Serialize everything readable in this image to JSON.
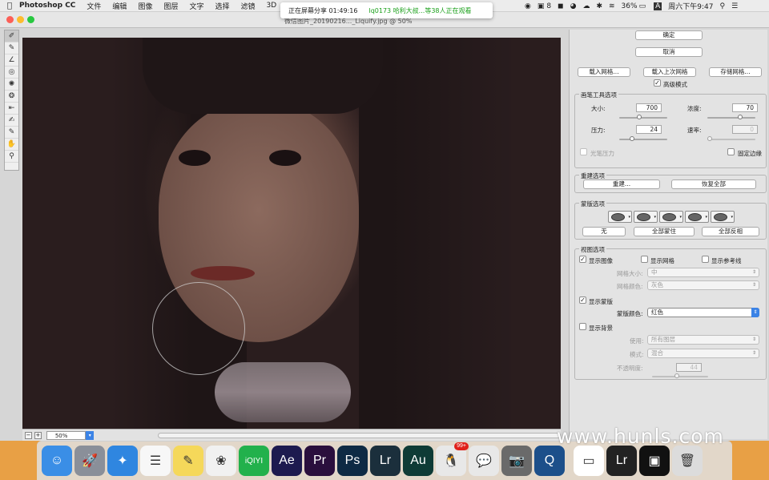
{
  "menubar": {
    "apple": "",
    "app_name": "Photoshop CC",
    "items": [
      "文件",
      "编辑",
      "图像",
      "图层",
      "文字",
      "选择",
      "滤镜",
      "3D"
    ],
    "status": {
      "badge": "8",
      "battery": "36%",
      "input_method": "A",
      "clock": "周六下午9:47"
    }
  },
  "share_banner": {
    "status": "正在屏幕分享 01:49:16",
    "viewers": "lq0173 哈利大叔...等38人正在观看"
  },
  "window": {
    "file_title": "微信图片_20190216..._Liquify.jpg @ 50%"
  },
  "toolbar": {
    "tools": [
      {
        "name": "forward-warp-tool",
        "glyph": "✐"
      },
      {
        "name": "reconstruct-tool",
        "glyph": "✎"
      },
      {
        "name": "smooth-tool",
        "glyph": "∠"
      },
      {
        "name": "twirl-clockwise-tool",
        "glyph": "◎"
      },
      {
        "name": "pucker-tool",
        "glyph": "✺"
      },
      {
        "name": "bloat-tool",
        "glyph": "❂"
      },
      {
        "name": "push-left-tool",
        "glyph": "⇤"
      },
      {
        "name": "freeze-mask-tool",
        "glyph": "✍"
      },
      {
        "name": "thaw-mask-tool",
        "glyph": "✎"
      },
      {
        "name": "hand-tool",
        "glyph": "✋"
      },
      {
        "name": "zoom-tool",
        "glyph": "⚲"
      }
    ]
  },
  "statusbar": {
    "zoom_out": "−",
    "zoom_in": "+",
    "zoom": "50%"
  },
  "panel": {
    "ok": "确定",
    "cancel": "取消",
    "load_mesh": "载入网格...",
    "load_last_mesh": "载入上次网格",
    "save_mesh": "存储网格...",
    "advanced_mode": "高级模式",
    "brush_options": {
      "title": "画笔工具选项",
      "size_label": "大小:",
      "size": "700",
      "density_label": "浓度:",
      "density": "70",
      "pressure_label": "压力:",
      "pressure": "24",
      "rate_label": "速率:",
      "rate": "0",
      "stylus_pressure": "光笔压力",
      "pin_edges": "固定边缘",
      "sliders": {
        "size": 0.4,
        "density": 0.7,
        "pressure": 0.24,
        "rate": 0.0
      }
    },
    "reconstruct_options": {
      "title": "重建选项",
      "reconstruct": "重建...",
      "restore_all": "恢复全部"
    },
    "mask_options": {
      "title": "蒙版选项",
      "none": "无",
      "mask_all": "全部蒙住",
      "invert_all": "全部反相"
    },
    "view_options": {
      "title": "视图选项",
      "show_image": "显示图像",
      "show_mesh": "显示网格",
      "show_guides": "显示参考线",
      "mesh_size_label": "网格大小:",
      "mesh_size": "中",
      "mesh_color_label": "网格颜色:",
      "mesh_color": "灰色",
      "show_mask": "显示蒙版",
      "mask_color_label": "蒙版颜色:",
      "mask_color": "红色",
      "show_backdrop": "显示背景",
      "use_label": "使用:",
      "use": "所有图层",
      "mode_label": "模式:",
      "mode": "混合",
      "opacity_label": "不透明度:",
      "opacity": "44",
      "opacity_slider": 0.44,
      "check_mark": "✓"
    }
  },
  "watermark": "www.hunls.com",
  "dock": {
    "apps": [
      {
        "name": "finder",
        "label": "☺",
        "color": "#3a8ee6"
      },
      {
        "name": "launchpad",
        "label": "🚀",
        "color": "#8a8f99"
      },
      {
        "name": "safari",
        "label": "✦",
        "color": "#2f86e0"
      },
      {
        "name": "reminders",
        "label": "☰",
        "color": "#f7f7f7"
      },
      {
        "name": "notes",
        "label": "✎",
        "color": "#f5d85a"
      },
      {
        "name": "photos",
        "label": "❀",
        "color": "#f1f1f1"
      },
      {
        "name": "iqiyi",
        "label": "iQIYI",
        "color": "#22b14c"
      },
      {
        "name": "after-effects",
        "label": "Ae",
        "color": "#1d1a4f"
      },
      {
        "name": "premiere",
        "label": "Pr",
        "color": "#2a0f3d"
      },
      {
        "name": "photoshop",
        "label": "Ps",
        "color": "#0e2a44"
      },
      {
        "name": "lightroom",
        "label": "Lr",
        "color": "#1b2f3c"
      },
      {
        "name": "audition",
        "label": "Au",
        "color": "#0e3b36"
      },
      {
        "name": "qq",
        "label": "🐧",
        "color": "#e8e8e8"
      },
      {
        "name": "wechat",
        "label": "💬",
        "color": "#e8e8e8"
      },
      {
        "name": "image-capture",
        "label": "📷",
        "color": "#6a6a6a"
      },
      {
        "name": "quicktime",
        "label": "Q",
        "color": "#1c4f8a"
      },
      {
        "name": "minimized-doc-1",
        "label": "▭",
        "color": "#ffffff"
      },
      {
        "name": "minimized-doc-2",
        "label": "Lr",
        "color": "#222222"
      },
      {
        "name": "minimized-doc-3",
        "label": "▣",
        "color": "#111111"
      },
      {
        "name": "trash",
        "label": "🗑",
        "color": "#dcdcdc"
      }
    ],
    "qq_badge": "99+"
  }
}
